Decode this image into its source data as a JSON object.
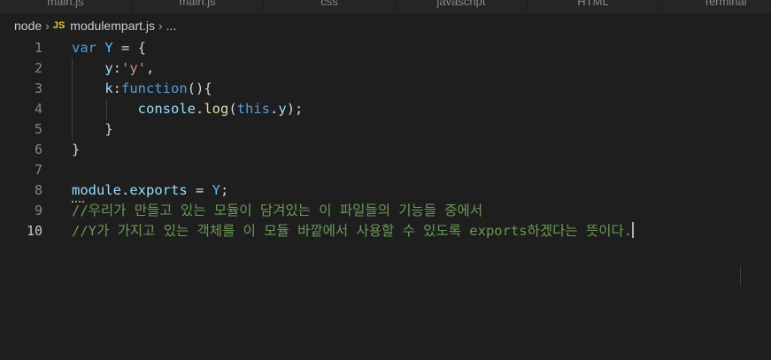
{
  "tabs": [
    {
      "label": "main.js"
    },
    {
      "label": "main.js"
    },
    {
      "label": "css"
    },
    {
      "label": "javascript"
    },
    {
      "label": "HTML"
    },
    {
      "label": "Terminal"
    }
  ],
  "breadcrumb": {
    "folder": "node",
    "file_icon": "JS",
    "file": "modulempart.js",
    "symbol": "..."
  },
  "editor": {
    "lines": [
      {
        "number": "1"
      },
      {
        "number": "2"
      },
      {
        "number": "3"
      },
      {
        "number": "4"
      },
      {
        "number": "5"
      },
      {
        "number": "6"
      },
      {
        "number": "7"
      },
      {
        "number": "8"
      },
      {
        "number": "9"
      },
      {
        "number": "10"
      }
    ],
    "tokens": {
      "l1_kw": "var",
      "l1_name": "Y",
      "l1_rest": " = {",
      "l2_key": "y",
      "l2_colon": ":",
      "l2_str": "'y'",
      "l2_comma": ",",
      "l3_key": "k",
      "l3_colon": ":",
      "l3_kw": "function",
      "l3_rest": "(){",
      "l4_obj": "console",
      "l4_dot": ".",
      "l4_fn": "log",
      "l4_open": "(",
      "l4_this": "this",
      "l4_dot2": ".",
      "l4_prop": "y",
      "l4_close": ");",
      "l5": "}",
      "l6": "}",
      "l8_obj": "module",
      "l8_dot": ".",
      "l8_prop": "exports",
      "l8_eq": " = ",
      "l8_name": "Y",
      "l8_semi": ";",
      "l9_comment": "//우리가 만들고 있는 모듈이 담겨있는 이 파일들의 기능들 중에서",
      "l10_comment": "//Y가 가지고 있는 객체를 이 모듈 바깥에서 사용할 수 있도록 exports하겠다는 뜻이다."
    }
  },
  "colors": {
    "background": "#1e1e1e",
    "keyword": "#569cd6",
    "variable": "#9cdcfe",
    "constant": "#4fc1ff",
    "function": "#dcdcaa",
    "string": "#ce9178",
    "comment": "#6a9955"
  }
}
